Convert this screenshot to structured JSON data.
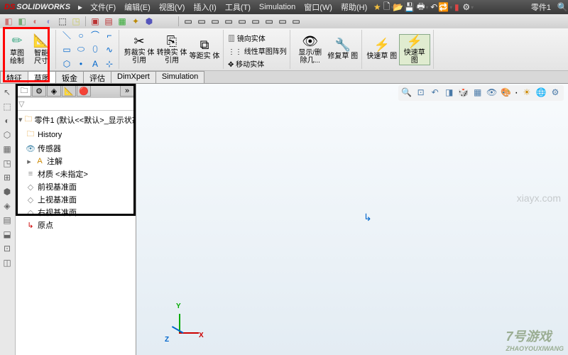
{
  "app": {
    "name": "SOLIDWORKS",
    "logo_ds": "DS"
  },
  "menu": {
    "file": "文件(F)",
    "edit": "编辑(E)",
    "view": "视图(V)",
    "insert": "插入(I)",
    "tools": "工具(T)",
    "simulation": "Simulation",
    "window": "窗口(W)",
    "help": "帮助(H)"
  },
  "document": "零件1",
  "ribbon": {
    "sketch": "草图\n绘制",
    "smart_dim": "智能\n尺寸",
    "trim": "剪裁实\n体引用",
    "convert": "转换实\n体引用",
    "offset": "等距实\n体",
    "mirror": "镜向实体",
    "pattern": "线性草图阵列",
    "move": "移动实体",
    "display": "显示/删\n除几...",
    "repair": "修复草\n图",
    "rapid_sketch": "快速草\n图",
    "rapid_sketch2": "快速草\n图"
  },
  "tabs": {
    "feature": "特征",
    "sketch": "草图",
    "sheetmetal": "钣金",
    "evaluate": "评估",
    "dimxpert": "DimXpert",
    "simulation": "Simulation"
  },
  "feature_tree": {
    "root": "零件1 (默认<<默认>_显示状态",
    "history": "History",
    "sensors": "传感器",
    "annotations": "注解",
    "material": "材质 <未指定>",
    "front": "前视基准面",
    "top": "上视基准面",
    "right": "右视基准面",
    "origin": "原点"
  },
  "triad": {
    "x": "X",
    "y": "Y",
    "z": "Z"
  },
  "watermark": {
    "big": "7号游戏",
    "small": "ZHAOYOUXIWANG"
  },
  "url": "xiayx.com"
}
